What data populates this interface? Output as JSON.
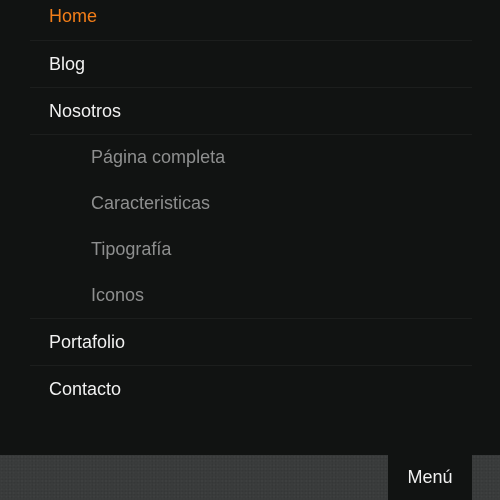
{
  "nav": {
    "items": [
      {
        "label": "Home",
        "active": true
      },
      {
        "label": "Blog",
        "active": false
      },
      {
        "label": "Nosotros",
        "active": false
      },
      {
        "label": "Portafolio",
        "active": false
      },
      {
        "label": "Contacto",
        "active": false
      }
    ],
    "submenu": [
      {
        "label": "Página completa"
      },
      {
        "label": "Caracteristicas"
      },
      {
        "label": "Tipografía"
      },
      {
        "label": "Iconos"
      }
    ]
  },
  "bottom_bar": {
    "menu_label": "Menú"
  },
  "colors": {
    "background": "#111312",
    "accent": "#f47e18",
    "text": "#f2f2f2",
    "subtext": "#8e8f8f",
    "bar": "#3a3c3c"
  }
}
